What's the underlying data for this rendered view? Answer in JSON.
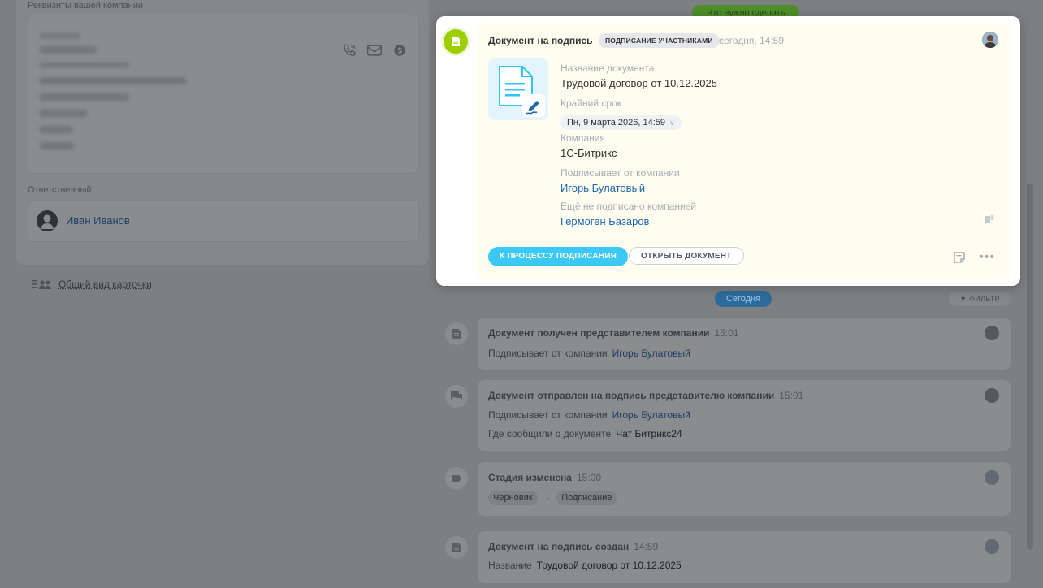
{
  "left": {
    "company_details_label": "Реквизиты вашей компании",
    "responsible_label": "Ответственный",
    "responsible_name": "Иван Иванов",
    "card_view_link": "Общий вид карточки"
  },
  "timeline": {
    "top_status_pill": "Что нужно сделать",
    "today_pill": "Сегодня",
    "filter_label": "ФИЛЬТР",
    "items": [
      {
        "title": "Документ получен представителем компании",
        "time": "15:01",
        "rows": [
          {
            "label": "Подписывает от компании",
            "value": "Игорь Булатовый"
          }
        ]
      },
      {
        "title": "Документ отправлен на подпись представителю компании",
        "time": "15:01",
        "rows": [
          {
            "label": "Подписывает от компании",
            "value": "Игорь Булатовый"
          },
          {
            "label": "Где сообщили о документе",
            "value": "Чат Битрикс24"
          }
        ]
      },
      {
        "title": "Стадия изменена",
        "time": "15:00",
        "stage_from": "Черновик",
        "stage_arrow": "→",
        "stage_to": "Подписание"
      },
      {
        "title": "Документ на подпись создан",
        "time": "14:59",
        "rows": [
          {
            "label": "Название",
            "value": "Трудовой договор от 10.12.2025"
          }
        ]
      }
    ]
  },
  "popup": {
    "title": "Документ на подпись",
    "badge": "ПОДПИСАНИЕ УЧАСТНИКАМИ",
    "time": "сегодня, 14:59",
    "doc_name_label": "Название документа",
    "doc_name": "Трудовой договор от 10.12.2025",
    "deadline_label": "Крайний срок",
    "deadline_value": "Пн, 9 марта 2026, 14:59",
    "company_label": "Компания",
    "company_value": "1С-Битрикс",
    "signer_label": "Подписывает от компании",
    "signer_value": "Игорь Булатовый",
    "not_signed_label": "Ещё не подписано компанией",
    "not_signed_value": "Гермоген Базаров",
    "primary_button": "К ПРОЦЕССУ ПОДПИСАНИЯ",
    "secondary_button": "ОТКРЫТЬ ДОКУМЕНТ",
    "more_glyph": "•••"
  },
  "colors": {
    "accent_blue": "#3bc8f5",
    "icon_green": "#9dcf00",
    "link_blue": "#2067b0"
  }
}
